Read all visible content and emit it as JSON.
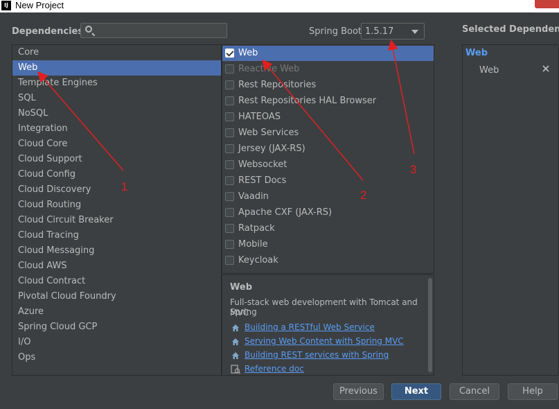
{
  "window": {
    "title": "New Project",
    "app_icon": "IJ"
  },
  "dependencies_label": "Dependencies",
  "search": {
    "value": "",
    "placeholder": ""
  },
  "spring_boot": {
    "label": "Spring Boot",
    "version": "1.5.17"
  },
  "selected_header": "Selected Dependencies",
  "categories": [
    "Core",
    "Web",
    "Template Engines",
    "SQL",
    "NoSQL",
    "Integration",
    "Cloud Core",
    "Cloud Support",
    "Cloud Config",
    "Cloud Discovery",
    "Cloud Routing",
    "Cloud Circuit Breaker",
    "Cloud Tracing",
    "Cloud Messaging",
    "Cloud AWS",
    "Cloud Contract",
    "Pivotal Cloud Foundry",
    "Azure",
    "Spring Cloud GCP",
    "I/O",
    "Ops"
  ],
  "selected_category_index": 1,
  "dependencies": [
    {
      "label": "Web",
      "checked": true,
      "disabled": false
    },
    {
      "label": "Reactive Web",
      "checked": false,
      "disabled": true
    },
    {
      "label": "Rest Repositories",
      "checked": false,
      "disabled": false
    },
    {
      "label": "Rest Repositories HAL Browser",
      "checked": false,
      "disabled": false
    },
    {
      "label": "HATEOAS",
      "checked": false,
      "disabled": false
    },
    {
      "label": "Web Services",
      "checked": false,
      "disabled": false
    },
    {
      "label": "Jersey (JAX-RS)",
      "checked": false,
      "disabled": false
    },
    {
      "label": "Websocket",
      "checked": false,
      "disabled": false
    },
    {
      "label": "REST Docs",
      "checked": false,
      "disabled": false
    },
    {
      "label": "Vaadin",
      "checked": false,
      "disabled": false
    },
    {
      "label": "Apache CXF (JAX-RS)",
      "checked": false,
      "disabled": false
    },
    {
      "label": "Ratpack",
      "checked": false,
      "disabled": false
    },
    {
      "label": "Mobile",
      "checked": false,
      "disabled": false
    },
    {
      "label": "Keycloak",
      "checked": false,
      "disabled": false
    }
  ],
  "description": {
    "title": "Web",
    "text_line1": "Full-stack web development with Tomcat and Spring",
    "text_line2": "MVC",
    "links": [
      {
        "label": "Building a RESTful Web Service",
        "icon": "home-icon"
      },
      {
        "label": "Serving Web Content with Spring MVC",
        "icon": "home-icon"
      },
      {
        "label": "Building REST services with Spring",
        "icon": "home-icon"
      },
      {
        "label": "Reference doc",
        "icon": "doc-icon"
      }
    ]
  },
  "selected": {
    "group": "Web",
    "items": [
      "Web"
    ]
  },
  "buttons": {
    "previous": "Previous",
    "next": "Next",
    "cancel": "Cancel",
    "help": "Help"
  },
  "annotations": [
    "1",
    "2",
    "3"
  ],
  "colors": {
    "selection": "#4b6eaf",
    "link": "#589df6",
    "annotation": "#e02020",
    "background": "#3c3f41"
  }
}
